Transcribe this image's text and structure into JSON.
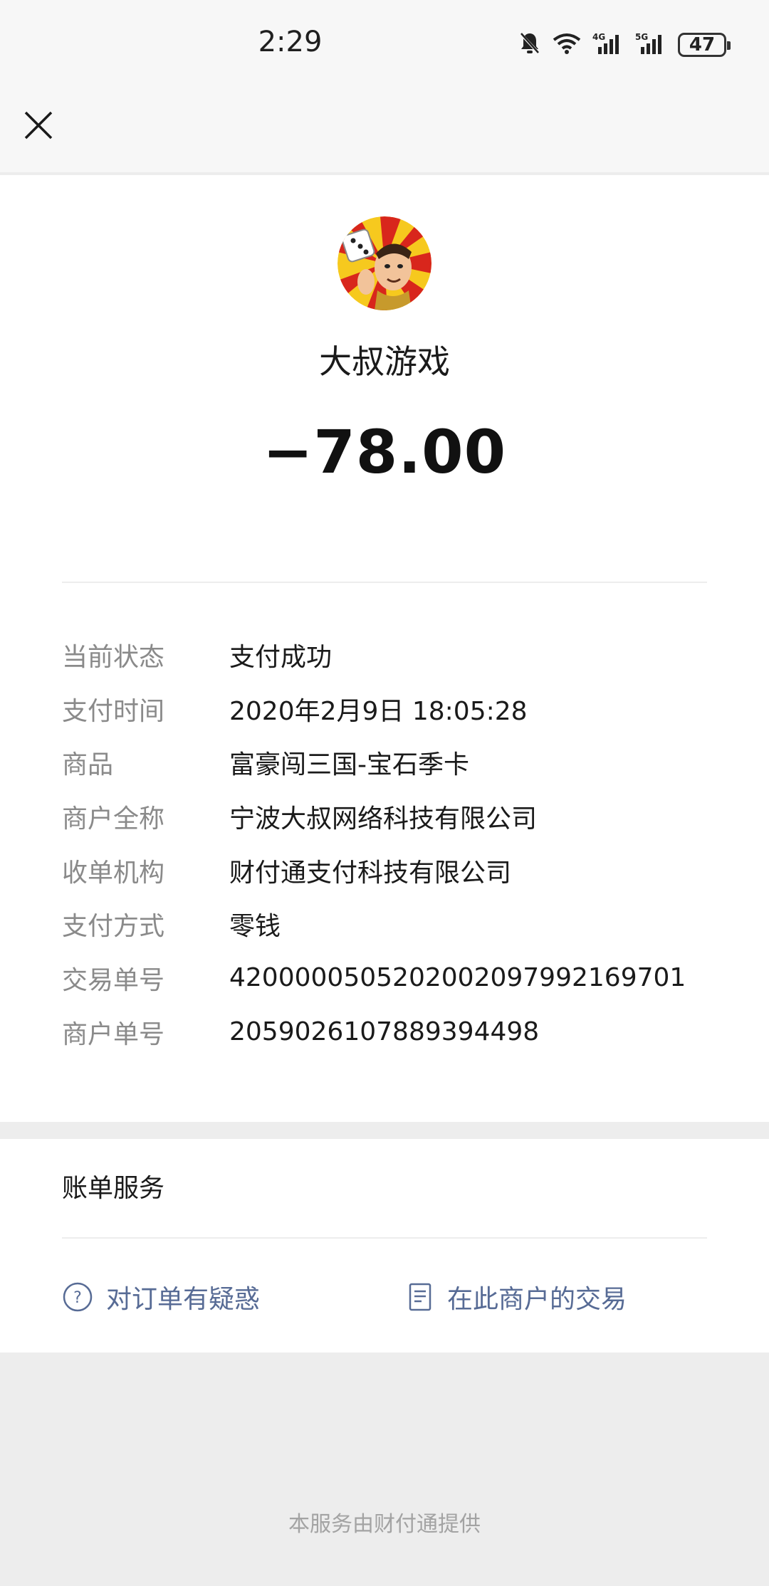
{
  "status_bar": {
    "time": "2:29",
    "battery": "47",
    "icons": [
      "bell-off-icon",
      "wifi-icon",
      "signal-4g-icon",
      "signal-5g-icon",
      "battery-icon"
    ]
  },
  "nav": {
    "close_icon": "close-icon"
  },
  "merchant": {
    "name": "大叔游戏",
    "avatar_icon": "merchant-avatar"
  },
  "amount": "−78.00",
  "details": [
    {
      "label": "当前状态",
      "value": "支付成功"
    },
    {
      "label": "支付时间",
      "value": "2020年2月9日 18:05:28"
    },
    {
      "label": "商品",
      "value": "富豪闯三国-宝石季卡"
    },
    {
      "label": "商户全称",
      "value": "宁波大叔网络科技有限公司"
    },
    {
      "label": "收单机构",
      "value": "财付通支付科技有限公司"
    },
    {
      "label": "支付方式",
      "value": "零钱"
    },
    {
      "label": "交易单号",
      "value": "4200000505202002097992169701"
    },
    {
      "label": "商户单号",
      "value": "2059026107889394498"
    }
  ],
  "service": {
    "title": "账单服务",
    "links": [
      {
        "label": "对订单有疑惑",
        "icon": "question-circle-icon"
      },
      {
        "label": "在此商户的交易",
        "icon": "document-icon"
      }
    ]
  },
  "footer": "本服务由财付通提供",
  "colors": {
    "link": "#576b95",
    "label": "#8a8a8a",
    "text": "#1a1a1a",
    "background": "#ededed"
  }
}
